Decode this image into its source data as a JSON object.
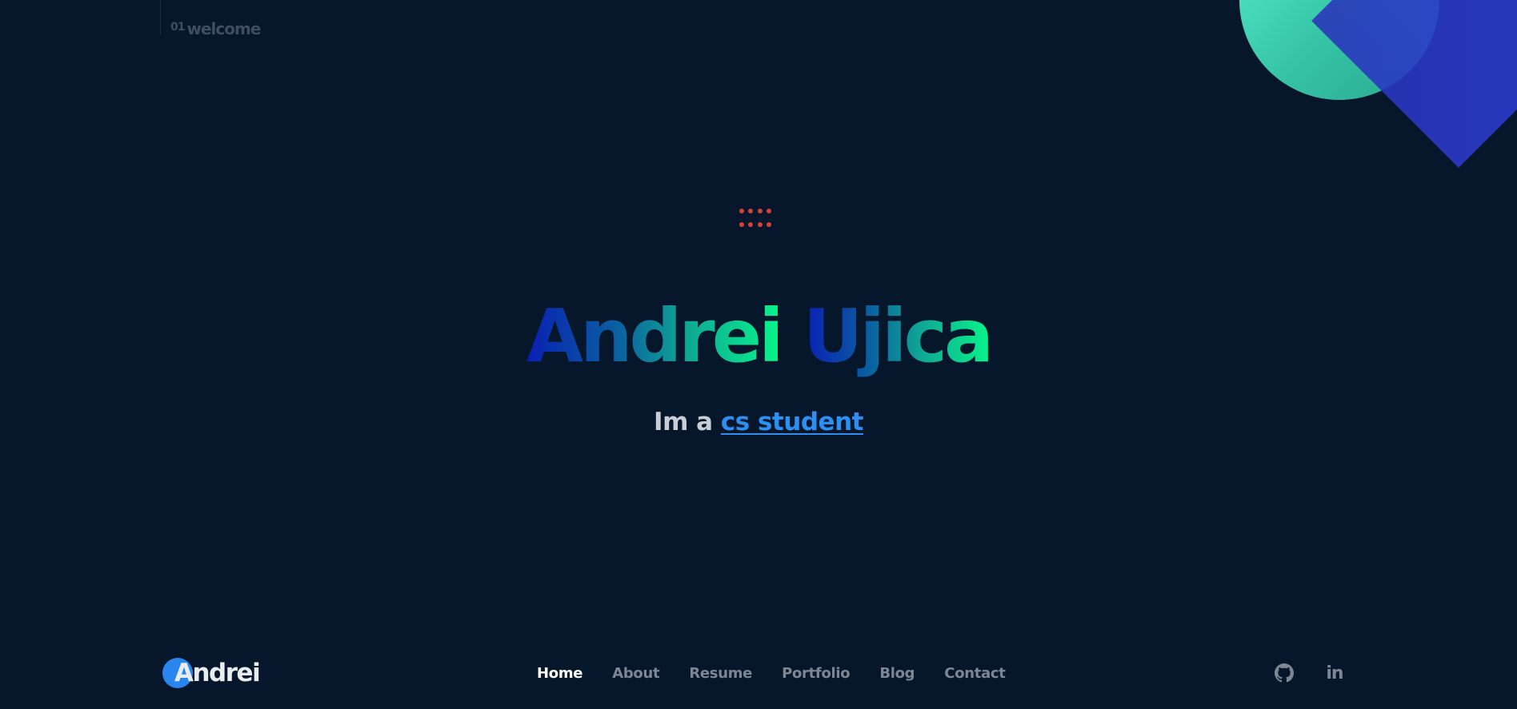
{
  "section": {
    "number": "01",
    "title": "welcome"
  },
  "hero": {
    "first_name": "Andrei",
    "last_name": "Ujica",
    "tagline_prefix": "Im a",
    "tagline_link": "cs student"
  },
  "footer": {
    "brand": "Andrei",
    "nav": {
      "home": "Home",
      "about": "About",
      "resume": "Resume",
      "portfolio": "Portfolio",
      "blog": "Blog",
      "contact": "Contact"
    },
    "social": {
      "github_icon": "github-icon",
      "linkedin_text": "in"
    }
  },
  "colors": {
    "background": "#06172b",
    "accent": "#2d8ff2",
    "dots": "#d4403a",
    "gradient_start": "#0a1fb4",
    "gradient_end": "#08f58a",
    "nav_inactive": "#7d8692",
    "nav_active": "#ffffff"
  }
}
